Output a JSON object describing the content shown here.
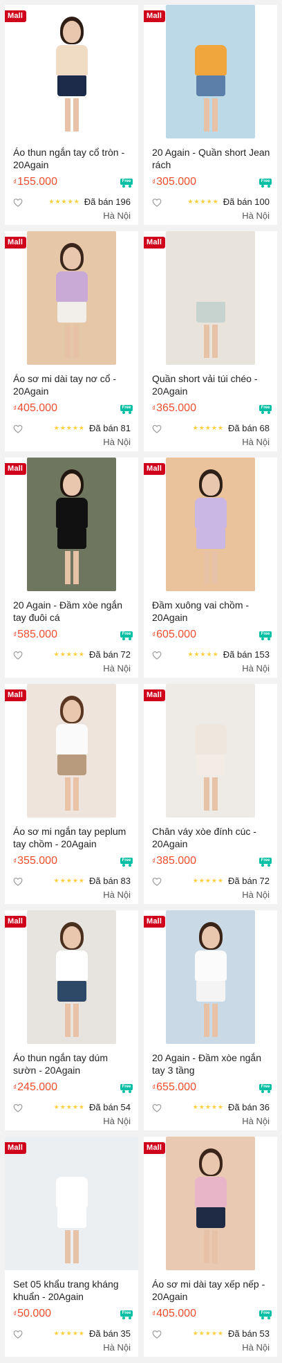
{
  "labels": {
    "mall_badge": "Mall",
    "free_ship_badge": "Free",
    "currency": "₫"
  },
  "colors": {
    "mall": "#d0011b",
    "price": "#ee4d2d",
    "free_ship": "#00bfa5",
    "stars": "#ffce3d"
  },
  "products": [
    {
      "name": "Áo thun ngắn tay cổ tròn - 20Again",
      "price": "155.000",
      "rating": 5,
      "sold": "Đã bán 196",
      "location": "Hà Nội",
      "photo": {
        "bg": "#ffffff",
        "hair": "#2d1d15",
        "top": "#f0dcc4",
        "bottom": "#1c2b4a"
      }
    },
    {
      "name": "20 Again - Quần short Jean rách",
      "price": "305.000",
      "rating": 5,
      "sold": "Đã bán 100",
      "location": "Hà Nội",
      "photo": {
        "bg": "#bcd9e8",
        "hair": "#bcd9e8",
        "top": "#f0a63c",
        "bottom": "#5b7fa8"
      }
    },
    {
      "name": "Áo sơ mi dài tay nơ cổ - 20Again",
      "price": "405.000",
      "rating": 5,
      "sold": "Đã bán 81",
      "location": "Hà Nội",
      "photo": {
        "bg": "#e6c7a8",
        "hair": "#3a261b",
        "top": "#c9a9d6",
        "bottom": "#f2efea"
      }
    },
    {
      "name": "Quần short vải túi chéo - 20Again",
      "price": "365.000",
      "rating": 5,
      "sold": "Đã bán 68",
      "location": "Hà Nội",
      "photo": {
        "bg": "#e8e4dc",
        "hair": "#e8e4dc",
        "top": "#e8e4dc",
        "bottom": "#c7d3cf"
      }
    },
    {
      "name": "20 Again - Đầm xòe ngắn tay đuôi cá",
      "price": "585.000",
      "rating": 5,
      "sold": "Đã bán 72",
      "location": "Hà Nội",
      "photo": {
        "bg": "#6f765f",
        "hair": "#221710",
        "top": "#111111",
        "bottom": "#111111"
      }
    },
    {
      "name": "Đầm xuông vai chồm - 20Again",
      "price": "605.000",
      "rating": 5,
      "sold": "Đã bán 153",
      "location": "Hà Nội",
      "photo": {
        "bg": "#eac39c",
        "hair": "#2f2017",
        "top": "#cbb7e3",
        "bottom": "#cbb7e3"
      }
    },
    {
      "name": "Áo sơ mi ngắn tay peplum tay chồm - 20Again",
      "price": "355.000",
      "rating": 5,
      "sold": "Đã bán 83",
      "location": "Hà Nội",
      "photo": {
        "bg": "#efe4db",
        "hair": "#5a3722",
        "top": "#fafafa",
        "bottom": "#b89a7d"
      }
    },
    {
      "name": "Chân váy xòe đính cúc - 20Again",
      "price": "385.000",
      "rating": 5,
      "sold": "Đã bán 72",
      "location": "Hà Nội",
      "photo": {
        "bg": "#eeeae6",
        "hair": "#eeeae6",
        "top": "#efe7de",
        "bottom": "#f3ece4"
      }
    },
    {
      "name": "Áo thun ngắn tay dúm sườn - 20Again",
      "price": "245.000",
      "rating": 5,
      "sold": "Đã bán 54",
      "location": "Hà Nội",
      "photo": {
        "bg": "#e7e3df",
        "hair": "#4a2e1e",
        "top": "#ffffff",
        "bottom": "#2e4868"
      }
    },
    {
      "name": "20 Again - Đầm xòe ngắn tay 3 tầng",
      "price": "655.000",
      "rating": 4,
      "sold": "Đã bán 36",
      "location": "Hà Nội",
      "photo": {
        "bg": "#c9dae6",
        "hair": "#3a2418",
        "top": "#fbfbfb",
        "bottom": "#f4f4f4"
      }
    },
    {
      "name": "Set 05 khẩu trang kháng khuẩn - 20Again",
      "price": "50.000",
      "rating": 5,
      "sold": "Đã bán 35",
      "location": "Hà Nội",
      "photo": {
        "bg": "#eceff2",
        "hair": "#eceff2",
        "top": "#ffffff",
        "bottom": "#ffffff"
      }
    },
    {
      "name": "Áo sơ mi dài tay xếp nếp - 20Again",
      "price": "405.000",
      "rating": 5,
      "sold": "Đã bán 53",
      "location": "Hà Nội",
      "photo": {
        "bg": "#e9c9b1",
        "hair": "#3b2419",
        "top": "#e7b4c8",
        "bottom": "#1f2b45"
      }
    }
  ]
}
